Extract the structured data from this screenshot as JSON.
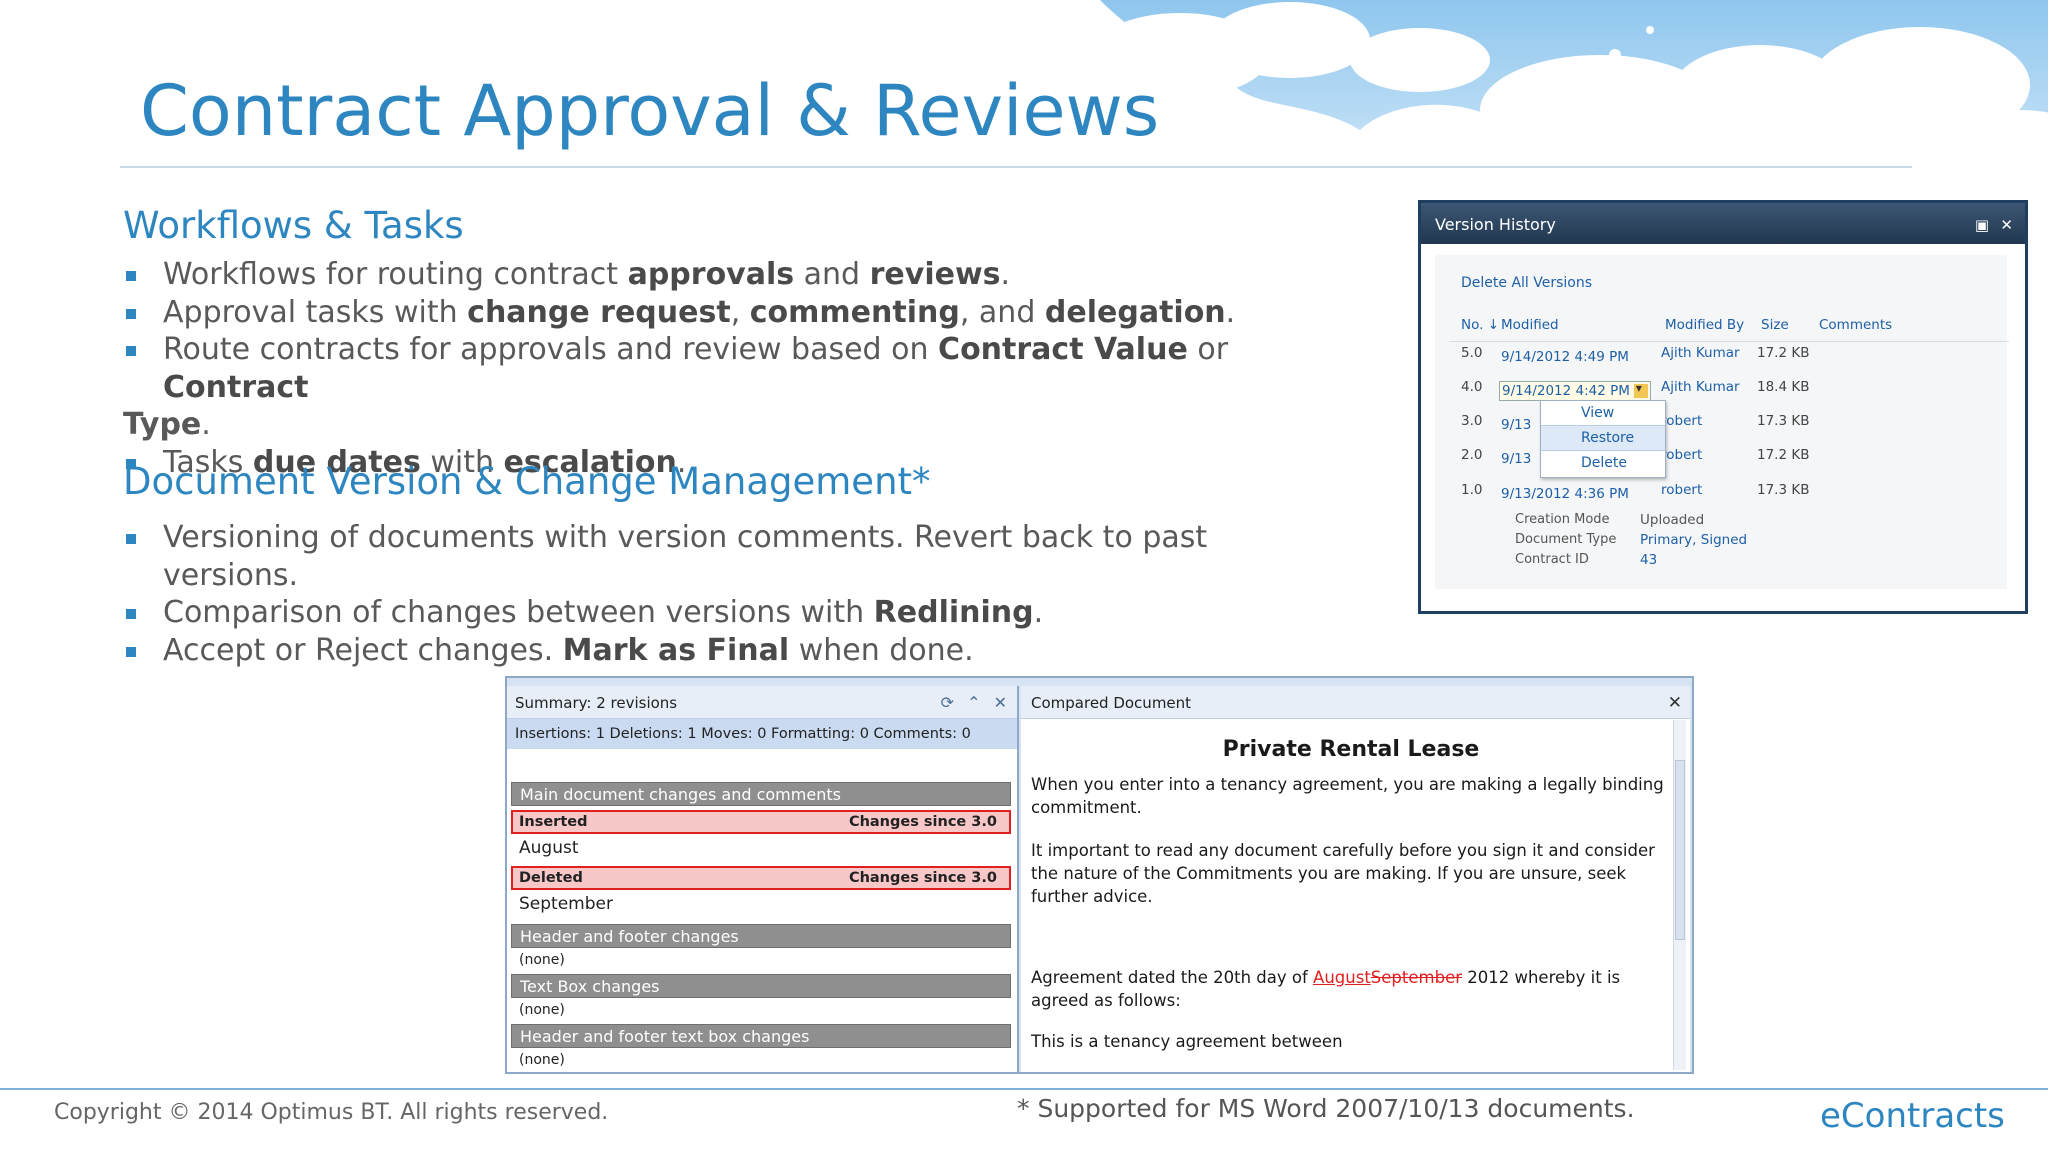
{
  "title": "Contract Approval & Reviews",
  "sections": [
    {
      "heading": "Workflows & Tasks",
      "bullets": [
        [
          "Workflows for routing contract ",
          "approvals",
          " and ",
          "reviews",
          "."
        ],
        [
          "Approval tasks with ",
          "change request",
          ", ",
          "commenting",
          ", and ",
          "delegation",
          "."
        ],
        [
          "Route contracts for approvals and review based on ",
          "Contract Value",
          " or ",
          "Contract",
          ""
        ],
        [
          "Tasks ",
          "due dates",
          " with ",
          "escalation",
          "."
        ]
      ],
      "continuation": [
        "Type",
        "."
      ]
    },
    {
      "heading": "Document Version & Change Management*",
      "bullets": [
        [
          "Versioning of documents with version comments. Revert back to past versions."
        ],
        [
          "Comparison of changes between versions with ",
          "Redlining",
          "."
        ],
        [
          "Accept or Reject changes. ",
          "Mark as Final",
          " when done."
        ]
      ]
    }
  ],
  "version_history": {
    "window_title": "Version History",
    "delete_all": "Delete All Versions",
    "columns": [
      "No. ↓",
      "Modified",
      "Modified By",
      "Size",
      "Comments"
    ],
    "rows": [
      {
        "no": "5.0",
        "modified": "9/14/2012 4:49 PM",
        "by": "Ajith Kumar",
        "size": "17.2 KB"
      },
      {
        "no": "4.0",
        "modified": "9/14/2012 4:42 PM",
        "by": "Ajith Kumar",
        "size": "18.4 KB"
      },
      {
        "no": "3.0",
        "modified": "9/13",
        "by": "robert",
        "size": "17.3 KB"
      },
      {
        "no": "2.0",
        "modified": "9/13",
        "by": "robert",
        "size": "17.2 KB"
      },
      {
        "no": "1.0",
        "modified": "9/13/2012 4:36 PM",
        "by": "robert",
        "size": "17.3 KB"
      }
    ],
    "context_menu": [
      "View",
      "Restore",
      "Delete"
    ],
    "meta": [
      {
        "label": "Creation Mode",
        "value": "Uploaded"
      },
      {
        "label": "Document Type",
        "value": "Primary, Signed"
      },
      {
        "label": "Contract ID",
        "value": "43"
      }
    ]
  },
  "compare": {
    "summary_title": "Summary: 2 revisions",
    "stats": "Insertions: 1  Deletions: 1  Moves: 0  Formatting: 0  Comments: 0",
    "main_group": "Main document changes and comments",
    "changes": [
      {
        "type": "Inserted",
        "since": "Changes since 3.0",
        "text": "August"
      },
      {
        "type": "Deleted",
        "since": "Changes since 3.0",
        "text": "September"
      }
    ],
    "other_groups": [
      {
        "name": "Header and footer changes",
        "value": "(none)"
      },
      {
        "name": "Text Box changes",
        "value": "(none)"
      },
      {
        "name": "Header and footer text box changes",
        "value": "(none)"
      }
    ],
    "doc_pane_title": "Compared Document",
    "doc_heading": "Private Rental Lease",
    "doc_para1": "When you enter into a tenancy agreement, you are making a legally binding commitment.",
    "doc_para2": "It important to read any document carefully before you sign it and consider the nature of the Commitments you are making. If you are unsure, seek further advice.",
    "doc_para3_pre": "Agreement dated the 20th day of ",
    "doc_ins": "August",
    "doc_del": "September",
    "doc_para3_post": " 2012 whereby it is agreed as follows:",
    "doc_para4": "This is a tenancy agreement between"
  },
  "footer": {
    "copyright": "Copyright © 2014 Optimus BT. All rights reserved.",
    "footnote": "* Supported for MS Word 2007/10/13 documents.",
    "brand": "eContracts"
  },
  "colors": {
    "accent": "#2e86c1",
    "redline": "#e02020"
  }
}
